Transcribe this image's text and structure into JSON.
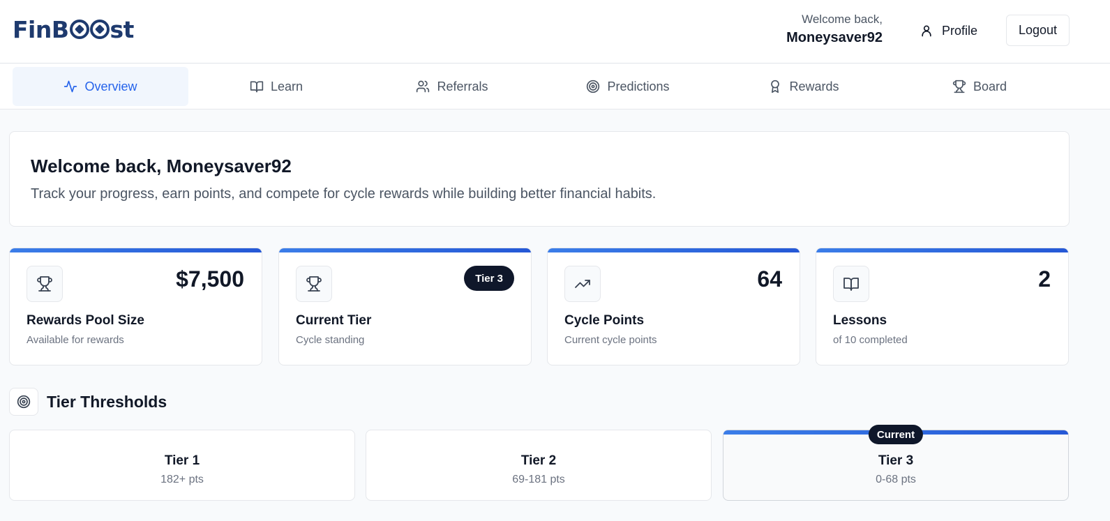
{
  "header": {
    "logo_text_left": "FinB",
    "logo_text_right": "st",
    "welcome_small": "Welcome back,",
    "username": "Moneysaver92",
    "profile_label": "Profile",
    "logout_label": "Logout"
  },
  "tabs": [
    {
      "label": "Overview",
      "icon": "activity-icon",
      "active": true
    },
    {
      "label": "Learn",
      "icon": "book-open-icon",
      "active": false
    },
    {
      "label": "Referrals",
      "icon": "users-icon",
      "active": false
    },
    {
      "label": "Predictions",
      "icon": "target-icon",
      "active": false
    },
    {
      "label": "Rewards",
      "icon": "award-icon",
      "active": false
    },
    {
      "label": "Board",
      "icon": "trophy-icon",
      "active": false
    }
  ],
  "welcome": {
    "title": "Welcome back, Moneysaver92",
    "subtitle": "Track your progress, earn points, and compete for cycle rewards while building better financial habits."
  },
  "stats": [
    {
      "icon": "trophy-icon",
      "value": "$7,500",
      "title": "Rewards Pool Size",
      "sub": "Available for rewards"
    },
    {
      "icon": "trophy-icon",
      "badge": "Tier 3",
      "title": "Current Tier",
      "sub": "Cycle standing"
    },
    {
      "icon": "trending-up-icon",
      "value": "64",
      "title": "Cycle Points",
      "sub": "Current cycle points"
    },
    {
      "icon": "book-open-icon",
      "value": "2",
      "title": "Lessons",
      "sub": "of 10 completed"
    }
  ],
  "tiers_section": {
    "title": "Tier Thresholds",
    "current_badge": "Current",
    "tiers": [
      {
        "name": "Tier 1",
        "range": "182+ pts",
        "current": false
      },
      {
        "name": "Tier 2",
        "range": "69-181 pts",
        "current": false
      },
      {
        "name": "Tier 3",
        "range": "0-68 pts",
        "current": true
      }
    ]
  },
  "colors": {
    "accent": "#2563eb",
    "brand": "#1e3a6e",
    "badge_bg": "#0f172a"
  }
}
